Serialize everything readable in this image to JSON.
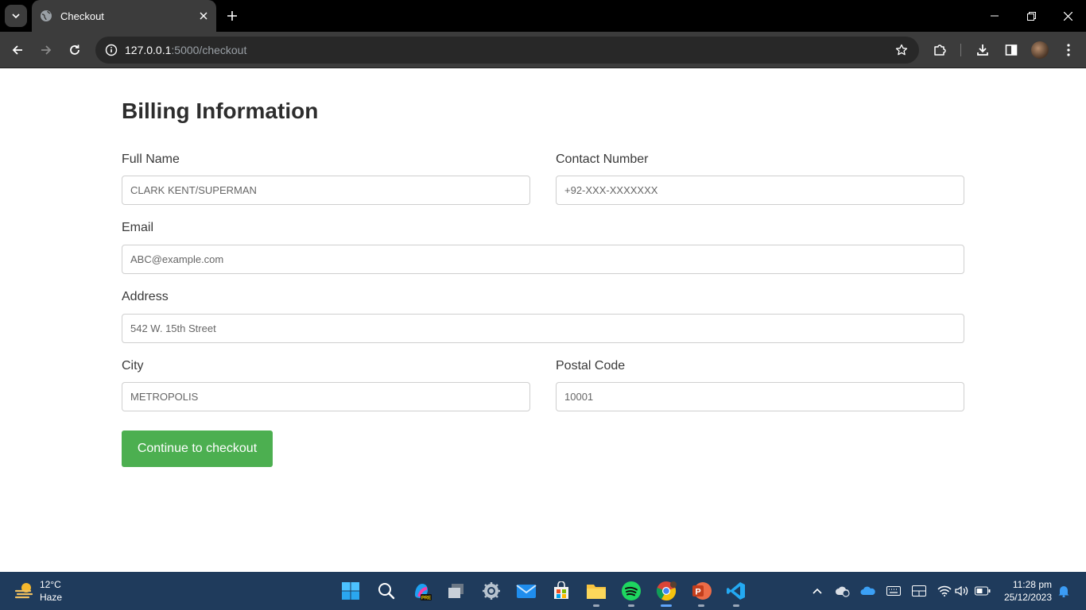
{
  "browser": {
    "tab_title": "Checkout",
    "url_host": "127.0.0.1",
    "url_path": ":5000/checkout"
  },
  "page": {
    "title": "Billing Information",
    "fields": {
      "full_name": {
        "label": "Full Name",
        "placeholder": "CLARK KENT/SUPERMAN"
      },
      "contact": {
        "label": "Contact Number",
        "placeholder": "+92-XXX-XXXXXXX"
      },
      "email": {
        "label": "Email",
        "placeholder": "ABC@example.com"
      },
      "address": {
        "label": "Address",
        "placeholder": "542 W. 15th Street"
      },
      "city": {
        "label": "City",
        "placeholder": "METROPOLIS"
      },
      "postal": {
        "label": "Postal Code",
        "placeholder": "10001"
      }
    },
    "submit_label": "Continue to checkout"
  },
  "taskbar": {
    "weather_temp": "12°C",
    "weather_condition": "Haze",
    "time": "11:28 pm",
    "date": "25/12/2023"
  },
  "colors": {
    "accent_button": "#4caf50",
    "taskbar_bg": "#1f3b5c",
    "chrome_bg": "#3c3c3c"
  }
}
